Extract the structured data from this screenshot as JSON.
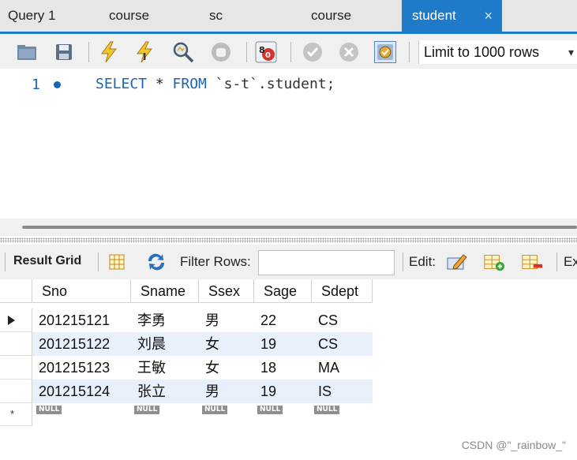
{
  "tabs": [
    {
      "label": "Query 1",
      "active": false
    },
    {
      "label": "course",
      "active": false
    },
    {
      "label": "sc",
      "active": false
    },
    {
      "label": "course",
      "active": false
    },
    {
      "label": "student",
      "active": true
    }
  ],
  "tab_close_glyph": "×",
  "toolbar": {
    "limit_value": "Limit to 1000 rows",
    "icons": [
      "open-folder-icon",
      "save-icon",
      "execute-icon",
      "execute-current-icon",
      "explain-icon",
      "stop-icon",
      "toggle-error-icon",
      "commit-icon",
      "rollback-icon",
      "autocommit-icon"
    ]
  },
  "editor": {
    "line_number": "1",
    "sql": {
      "select": "SELECT",
      "star": " * ",
      "from": "FROM",
      "rest": " `s-t`.student;"
    }
  },
  "result_toolbar": {
    "result_grid_label": "Result Grid",
    "filter_label": "Filter Rows:",
    "filter_value": "",
    "edit_label": "Edit:",
    "export_label": "Ex"
  },
  "grid": {
    "columns": [
      "Sno",
      "Sname",
      "Ssex",
      "Sage",
      "Sdept"
    ],
    "rows": [
      [
        "201215121",
        "李勇",
        "男",
        "22",
        "CS"
      ],
      [
        "201215122",
        "刘晨",
        "女",
        "19",
        "CS"
      ],
      [
        "201215123",
        "王敏",
        "女",
        "18",
        "MA"
      ],
      [
        "201215124",
        "张立",
        "男",
        "19",
        "IS"
      ]
    ],
    "null_label": "NULL",
    "new_row_marker": "*"
  },
  "watermark": "CSDN @\"_rainbow_\"",
  "colors": {
    "accent": "#1e7bc9",
    "keyword": "#1a64b4",
    "stripe": "#e8f0fb"
  }
}
